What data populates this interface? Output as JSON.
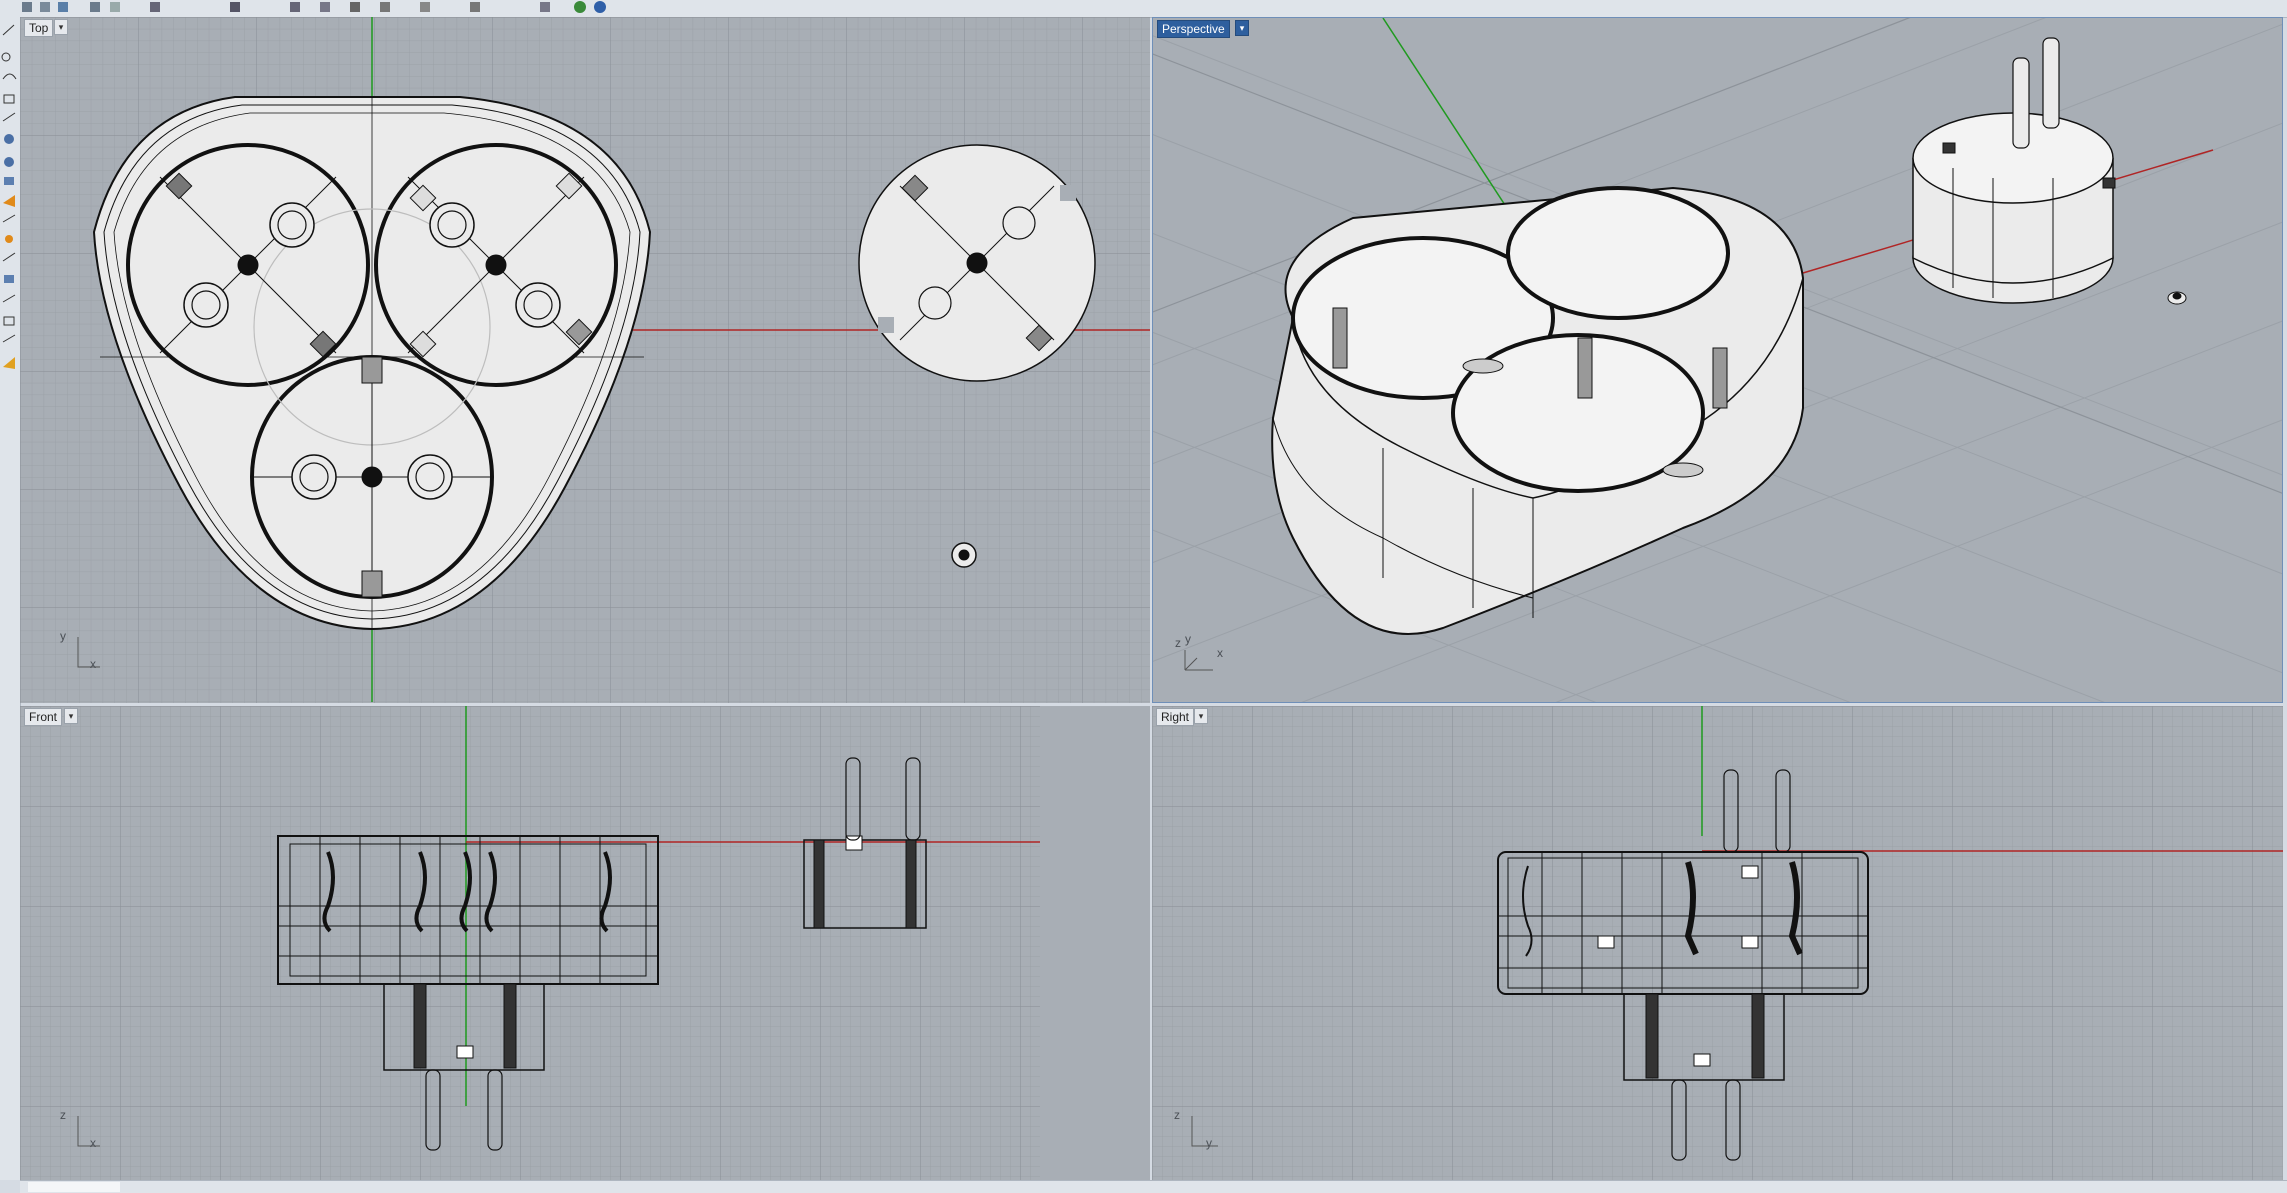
{
  "viewports": {
    "top": {
      "label": "Top",
      "axis_v": "y",
      "axis_h": "x"
    },
    "perspective": {
      "label": "Perspective",
      "axis_v": "z",
      "axis_h": "x",
      "axis_d": "y"
    },
    "front": {
      "label": "Front",
      "axis_v": "z",
      "axis_h": "x"
    },
    "right": {
      "label": "Right",
      "axis_v": "z",
      "axis_h": "y"
    }
  },
  "menu_glyph": "▾",
  "colors": {
    "viewport_bg": "#a8aeb5",
    "grid_minor": "#9ba1a8",
    "grid_major": "#8d939a",
    "x_axis": "#b02525",
    "y_axis": "#1f9a1f",
    "model_fill": "#ebebeb",
    "model_line": "#111111",
    "active_label": "#2e5f9e"
  },
  "icons": {
    "top_toolbar": "command-icons",
    "left_toolbar": "drawing-tool-icons"
  }
}
